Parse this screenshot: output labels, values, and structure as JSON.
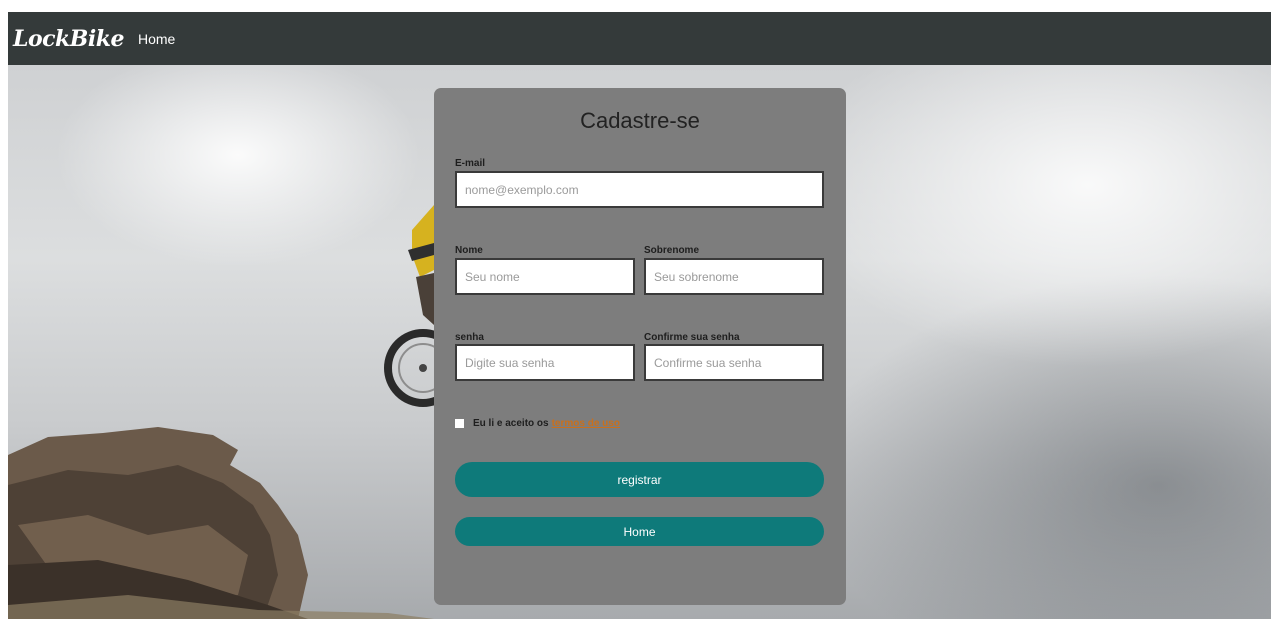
{
  "navbar": {
    "brand": "LockBike",
    "home_link": "Home"
  },
  "form": {
    "title": "Cadastre-se",
    "email": {
      "label": "E-mail",
      "placeholder": "nome@exemplo.com",
      "value": ""
    },
    "first_name": {
      "label": "Nome",
      "placeholder": "Seu nome",
      "value": ""
    },
    "last_name": {
      "label": "Sobrenome",
      "placeholder": "Seu sobrenome",
      "value": ""
    },
    "password": {
      "label": "senha",
      "placeholder": "Digite sua senha",
      "value": ""
    },
    "password_confirm": {
      "label": "Confirme sua senha",
      "placeholder": "Confirme sua senha",
      "value": ""
    },
    "terms": {
      "text": "Eu li e aceito os",
      "link": "termos de uso",
      "checked": false
    },
    "register_button": "registrar",
    "home_button": "Home"
  },
  "colors": {
    "navbar_bg": "#343a3a",
    "card_bg": "#7d7d7d",
    "button_bg": "#0e7a7a",
    "link": "#c8701e"
  },
  "icons": {
    "hero_background": "mountain-bike-rider-image"
  }
}
